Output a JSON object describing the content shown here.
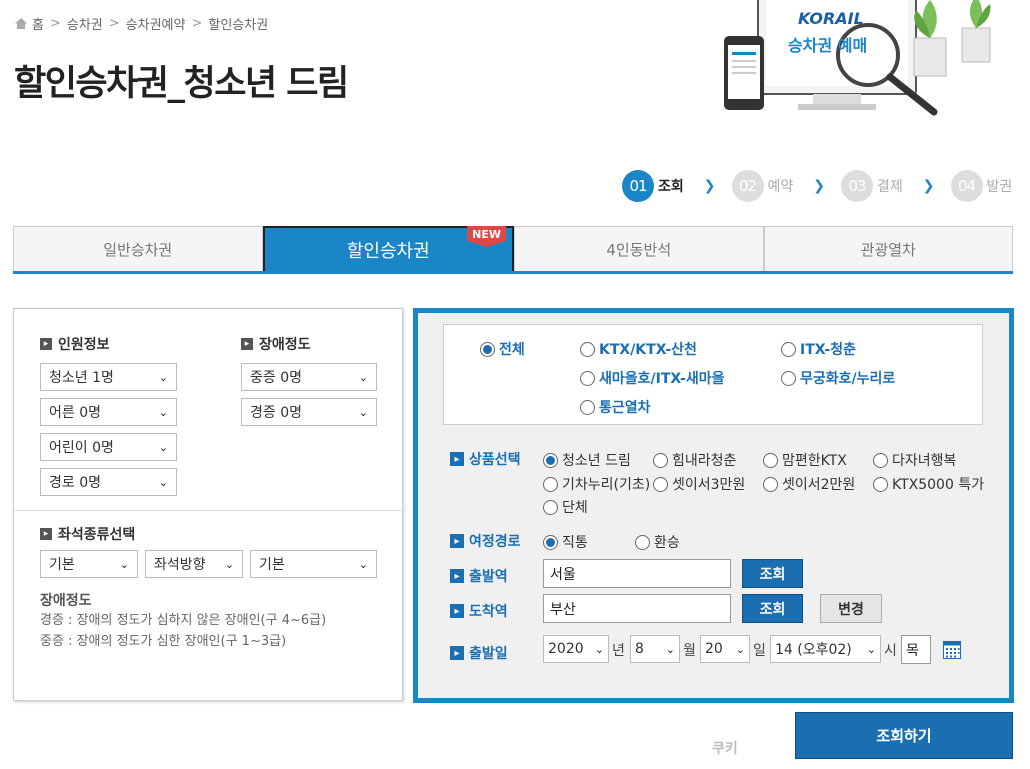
{
  "breadcrumb": [
    "홈",
    "승차권",
    "승차권예약",
    "할인승차권"
  ],
  "page_title": "할인승차권_청소년 드림",
  "hero": {
    "brand": "KORAIL",
    "caption": "승차권 예매"
  },
  "steps": [
    {
      "num": "01",
      "label": "조회",
      "active": true
    },
    {
      "num": "02",
      "label": "예약",
      "active": false
    },
    {
      "num": "03",
      "label": "결제",
      "active": false
    },
    {
      "num": "04",
      "label": "발권",
      "active": false
    }
  ],
  "tabs": [
    {
      "label": "일반승차권"
    },
    {
      "label": "할인승차권",
      "badge": "NEW"
    },
    {
      "label": "4인동반석"
    },
    {
      "label": "관광열차"
    }
  ],
  "passenger": {
    "title": "인원정보",
    "selects": [
      "청소년 1명",
      "어른 0명",
      "어린이 0명",
      "경로 0명"
    ]
  },
  "disability": {
    "title": "장애정도",
    "selects": [
      "중증 0명",
      "경증 0명"
    ]
  },
  "seat": {
    "title": "좌석종류선택",
    "selects": [
      "기본",
      "좌석방향",
      "기본"
    ]
  },
  "disability_note": {
    "title": "장애정도",
    "lines": [
      "경증 : 장애의 정도가 심하지 않은 장애인(구 4~6급)",
      "중증 : 장애의 정도가 심한 장애인(구 1~3급)"
    ]
  },
  "train_types": [
    {
      "label": "전체",
      "checked": true
    },
    {
      "label": "KTX/KTX-산천",
      "checked": false
    },
    {
      "label": "ITX-청춘",
      "checked": false
    },
    {
      "label": "새마을호/ITX-새마을",
      "checked": false
    },
    {
      "label": "무궁화호/누리로",
      "checked": false
    },
    {
      "label": "통근열차",
      "checked": false
    }
  ],
  "product": {
    "label": "상품선택",
    "options": [
      {
        "label": "청소년 드림",
        "checked": true
      },
      {
        "label": "힘내라청춘",
        "checked": false
      },
      {
        "label": "맘편한KTX",
        "checked": false
      },
      {
        "label": "다자녀행복",
        "checked": false
      },
      {
        "label": "기차누리(기초)",
        "checked": false
      },
      {
        "label": "셋이서3만원",
        "checked": false
      },
      {
        "label": "셋이서2만원",
        "checked": false
      },
      {
        "label": "KTX5000 특가",
        "checked": false
      },
      {
        "label": "단체",
        "checked": false
      }
    ]
  },
  "route": {
    "label": "여정경로",
    "options": [
      {
        "label": "직통",
        "checked": true
      },
      {
        "label": "환승",
        "checked": false
      }
    ]
  },
  "departure": {
    "label": "출발역",
    "value": "서울",
    "button": "조회"
  },
  "arrival": {
    "label": "도착역",
    "value": "부산",
    "button": "조회",
    "swap_button": "변경"
  },
  "date": {
    "label": "출발일",
    "year": "2020",
    "year_unit": "년",
    "month": "8",
    "month_unit": "월",
    "day": "20",
    "day_unit": "일",
    "hour": "14 (오후02)",
    "hour_unit": "시",
    "weekday": "목"
  },
  "search_button": "조회하기",
  "watermark": "쿠키",
  "colors": {
    "accent": "#1b86c7",
    "button": "#1b6fb1",
    "badge": "#e04848"
  }
}
